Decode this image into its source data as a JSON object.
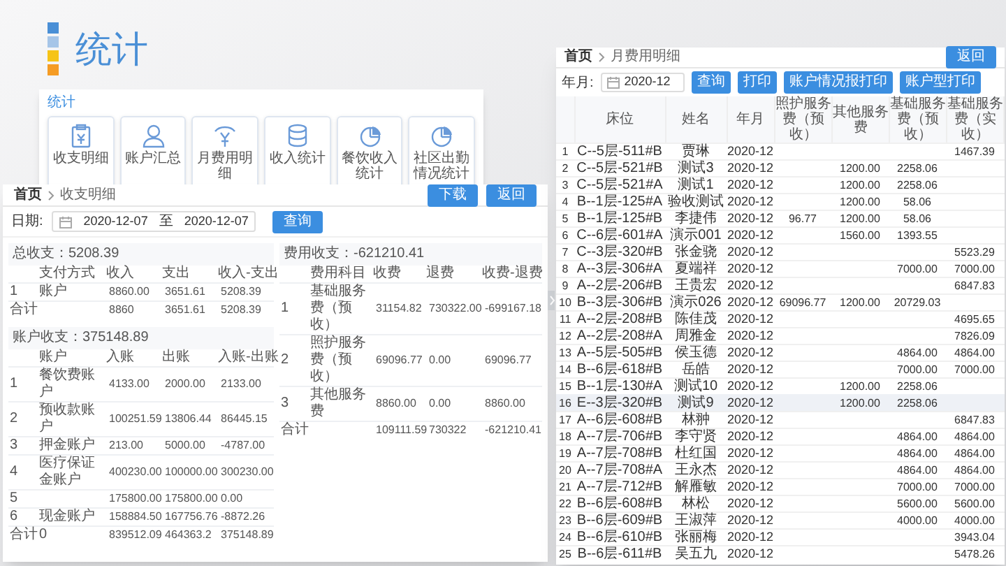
{
  "page_title": "统计",
  "stat_menu": {
    "title": "统计",
    "items": [
      {
        "label": "收支明细",
        "kind": "clipboard"
      },
      {
        "label": "账户汇总",
        "kind": "person"
      },
      {
        "label": "月费用明细",
        "kind": "coin"
      },
      {
        "label": "收入统计",
        "kind": "database"
      },
      {
        "label": "餐饮收入统计",
        "kind": "pie"
      },
      {
        "label": "社区出勤情况统计",
        "kind": "pie"
      }
    ]
  },
  "income_window": {
    "breadcrumb": [
      "首页",
      "收支明细"
    ],
    "buttons": [
      "下载",
      "返回"
    ],
    "date_label": "日期:",
    "date_from": "2020-12-07",
    "date_sep": "至",
    "date_to": "2020-12-07",
    "query_button": "查询",
    "payment_table": {
      "title": "总收支：5208.39",
      "columns": [
        "",
        "支付方式",
        "收入",
        "支出",
        "收入-支出"
      ],
      "rows": [
        [
          "1",
          "账户",
          "8860.00",
          "3651.61",
          "5208.39"
        ]
      ],
      "total": {
        "label": "合计",
        "values": [
          "8860",
          "3651.61",
          "5208.39"
        ]
      }
    },
    "account_table": {
      "title": "账户收支：375148.89",
      "columns": [
        "",
        "账户",
        "入账",
        "出账",
        "入账-出账"
      ],
      "rows": [
        [
          "1",
          "餐饮费账户",
          "4133.00",
          "2000.00",
          "2133.00"
        ],
        [
          "2",
          "预收款账户",
          "100251.59",
          "13806.44",
          "86445.15"
        ],
        [
          "3",
          "押金账户",
          "213.00",
          "5000.00",
          "-4787.00"
        ],
        [
          "4",
          "医疗保证金账户",
          "400230.00",
          "100000.00",
          "300230.00"
        ],
        [
          "5",
          "",
          "175800.00",
          "175800.00",
          "0.00"
        ],
        [
          "6",
          "现金账户",
          "158884.50",
          "167756.76",
          "-8872.26"
        ]
      ],
      "total": {
        "label": "合计",
        "name": "0",
        "values": [
          "839512.09",
          "464363.2",
          "375148.89"
        ]
      }
    },
    "fee_table": {
      "title": "费用收支：-621210.41",
      "columns": [
        "",
        "费用科目",
        "收费",
        "退费",
        "收费-退费"
      ],
      "rows": [
        [
          "1",
          "基础服务费（预收）",
          "31154.82",
          "730322.00",
          "-699167.18"
        ],
        [
          "2",
          "照护服务费（预收）",
          "69096.77",
          "0.00",
          "69096.77"
        ],
        [
          "3",
          "其他服务费",
          "8860.00",
          "0.00",
          "8860.00"
        ]
      ],
      "total": {
        "label": "合计",
        "values": [
          "109111.59",
          "730322",
          "-621210.41"
        ]
      }
    }
  },
  "monthly_window": {
    "breadcrumb": [
      "首页",
      "月费用明细"
    ],
    "back_button": "返回",
    "month_label": "年月:",
    "month_value": "2020-12",
    "buttons": [
      "查询",
      "打印",
      "账户情况报打印",
      "账户型打印"
    ],
    "columns": [
      "",
      "床位",
      "姓名",
      "年月",
      "照护服务费（预收）",
      "其他服务费",
      "基础服务费（预收）",
      "基础服务费（实收）"
    ],
    "rows": [
      {
        "cells": [
          "1",
          "C--5层-511#B",
          "贾琳",
          "2020-12",
          "",
          "",
          "",
          "1467.39"
        ],
        "highlighted": false
      },
      {
        "cells": [
          "2",
          "C--5层-521#B",
          "测试3",
          "2020-12",
          "",
          "1200.00",
          "2258.06",
          ""
        ],
        "highlighted": false
      },
      {
        "cells": [
          "3",
          "C--5层-521#A",
          "测试1",
          "2020-12",
          "",
          "1200.00",
          "2258.06",
          ""
        ],
        "highlighted": false
      },
      {
        "cells": [
          "4",
          "B--1层-125#A",
          "验收测试",
          "2020-12",
          "",
          "1200.00",
          "58.06",
          ""
        ],
        "highlighted": false
      },
      {
        "cells": [
          "5",
          "B--1层-125#B",
          "李捷伟",
          "2020-12",
          "96.77",
          "1200.00",
          "58.06",
          ""
        ],
        "highlighted": false
      },
      {
        "cells": [
          "6",
          "C--6层-601#A",
          "演示001",
          "2020-12",
          "",
          "1560.00",
          "1393.55",
          ""
        ],
        "highlighted": false
      },
      {
        "cells": [
          "7",
          "C--3层-320#B",
          "张金骁",
          "2020-12",
          "",
          "",
          "",
          "5523.29"
        ],
        "highlighted": false
      },
      {
        "cells": [
          "8",
          "A--3层-306#A",
          "夏端祥",
          "2020-12",
          "",
          "",
          "7000.00",
          "7000.00"
        ],
        "highlighted": false
      },
      {
        "cells": [
          "9",
          "A--2层-206#B",
          "王贵宏",
          "2020-12",
          "",
          "",
          "",
          "6847.83"
        ],
        "highlighted": false
      },
      {
        "cells": [
          "10",
          "B--3层-306#B",
          "演示026",
          "2020-12",
          "69096.77",
          "1200.00",
          "20729.03",
          ""
        ],
        "highlighted": false
      },
      {
        "cells": [
          "11",
          "A--2层-208#B",
          "陈佳茂",
          "2020-12",
          "",
          "",
          "",
          "4695.65"
        ],
        "highlighted": false
      },
      {
        "cells": [
          "12",
          "A--2层-208#A",
          "周雅金",
          "2020-12",
          "",
          "",
          "",
          "7826.09"
        ],
        "highlighted": false
      },
      {
        "cells": [
          "13",
          "A--5层-505#B",
          "侯玉德",
          "2020-12",
          "",
          "",
          "4864.00",
          "4864.00"
        ],
        "highlighted": false
      },
      {
        "cells": [
          "14",
          "B--6层-618#B",
          "岳皓",
          "2020-12",
          "",
          "",
          "7000.00",
          "7000.00"
        ],
        "highlighted": false
      },
      {
        "cells": [
          "15",
          "B--1层-130#A",
          "测试10",
          "2020-12",
          "",
          "1200.00",
          "2258.06",
          ""
        ],
        "highlighted": false
      },
      {
        "cells": [
          "16",
          "E--3层-320#B",
          "测试9",
          "2020-12",
          "",
          "1200.00",
          "2258.06",
          ""
        ],
        "highlighted": true
      },
      {
        "cells": [
          "17",
          "A--6层-608#B",
          "林翀",
          "2020-12",
          "",
          "",
          "",
          "6847.83"
        ],
        "highlighted": false
      },
      {
        "cells": [
          "18",
          "A--7层-706#B",
          "李守贤",
          "2020-12",
          "",
          "",
          "4864.00",
          "4864.00"
        ],
        "highlighted": false
      },
      {
        "cells": [
          "19",
          "A--7层-708#B",
          "杜红国",
          "2020-12",
          "",
          "",
          "4864.00",
          "4864.00"
        ],
        "highlighted": false
      },
      {
        "cells": [
          "20",
          "A--7层-708#A",
          "王永杰",
          "2020-12",
          "",
          "",
          "4864.00",
          "4864.00"
        ],
        "highlighted": false
      },
      {
        "cells": [
          "21",
          "A--7层-712#B",
          "解雁敏",
          "2020-12",
          "",
          "",
          "7000.00",
          "7000.00"
        ],
        "highlighted": false
      },
      {
        "cells": [
          "22",
          "B--6层-608#B",
          "林松",
          "2020-12",
          "",
          "",
          "5600.00",
          "5600.00"
        ],
        "highlighted": false
      },
      {
        "cells": [
          "23",
          "B--6层-609#B",
          "王淑萍",
          "2020-12",
          "",
          "",
          "4000.00",
          "4000.00"
        ],
        "highlighted": false
      },
      {
        "cells": [
          "24",
          "B--6层-610#B",
          "张丽梅",
          "2020-12",
          "",
          "",
          "",
          "3943.04"
        ],
        "highlighted": false
      },
      {
        "cells": [
          "25",
          "B--6层-611#B",
          "吴五九",
          "2020-12",
          "",
          "",
          "",
          "5478.26"
        ],
        "highlighted": false
      }
    ]
  }
}
